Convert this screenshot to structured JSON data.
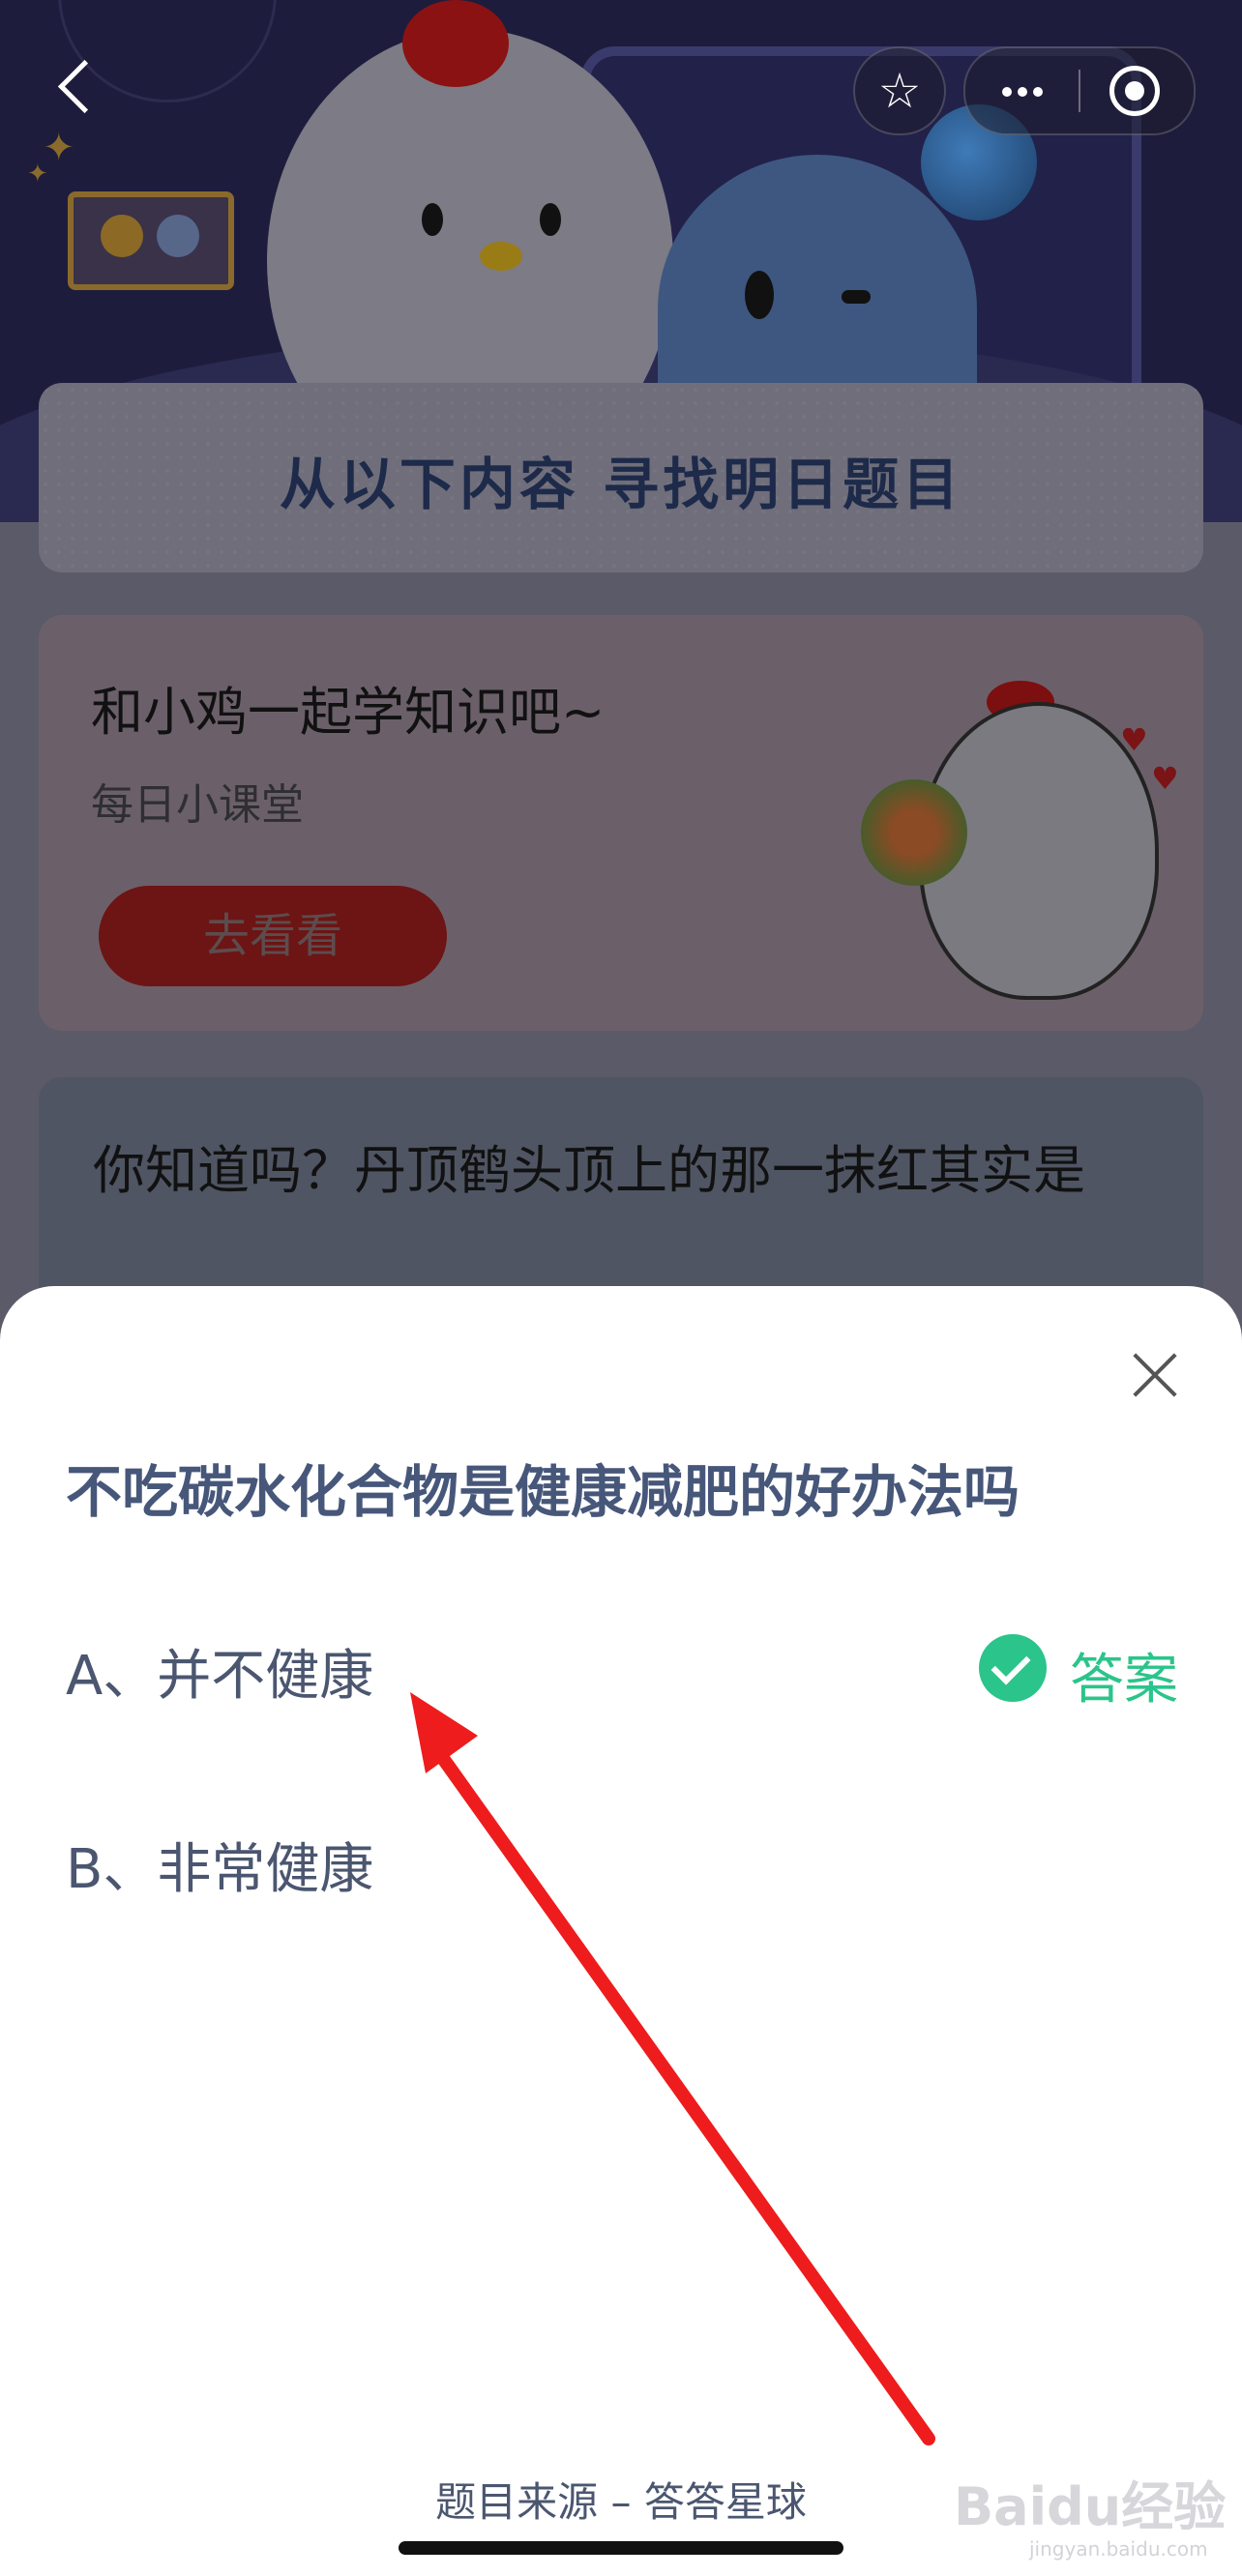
{
  "find_card": {
    "title": "从以下内容 寻找明日题目"
  },
  "class_card": {
    "title": "和小鸡一起学知识吧~",
    "subtitle": "每日小课堂",
    "button_label": "去看看"
  },
  "knowledge_card": {
    "text": "你知道吗？丹顶鹤头顶上的那一抹红其实是"
  },
  "quiz": {
    "question": "不吃碳水化合物是健康减肥的好办法吗",
    "options": [
      {
        "label": "A、并不健康",
        "is_answer": true
      },
      {
        "label": "B、非常健康",
        "is_answer": false
      }
    ],
    "answer_label": "答案",
    "source": "题目来源 – 答答星球"
  },
  "watermark": {
    "brand": "Baidu经验",
    "url": "jingyan.baidu.com"
  },
  "colors": {
    "accent_green": "#2bc48a",
    "question_blue": "#47577a",
    "annotation_red": "#ee1c1c"
  },
  "icons": [
    "back-chevron-icon",
    "star-icon",
    "more-dots-icon",
    "target-icon",
    "close-icon",
    "check-icon",
    "arrow-annotation"
  ]
}
